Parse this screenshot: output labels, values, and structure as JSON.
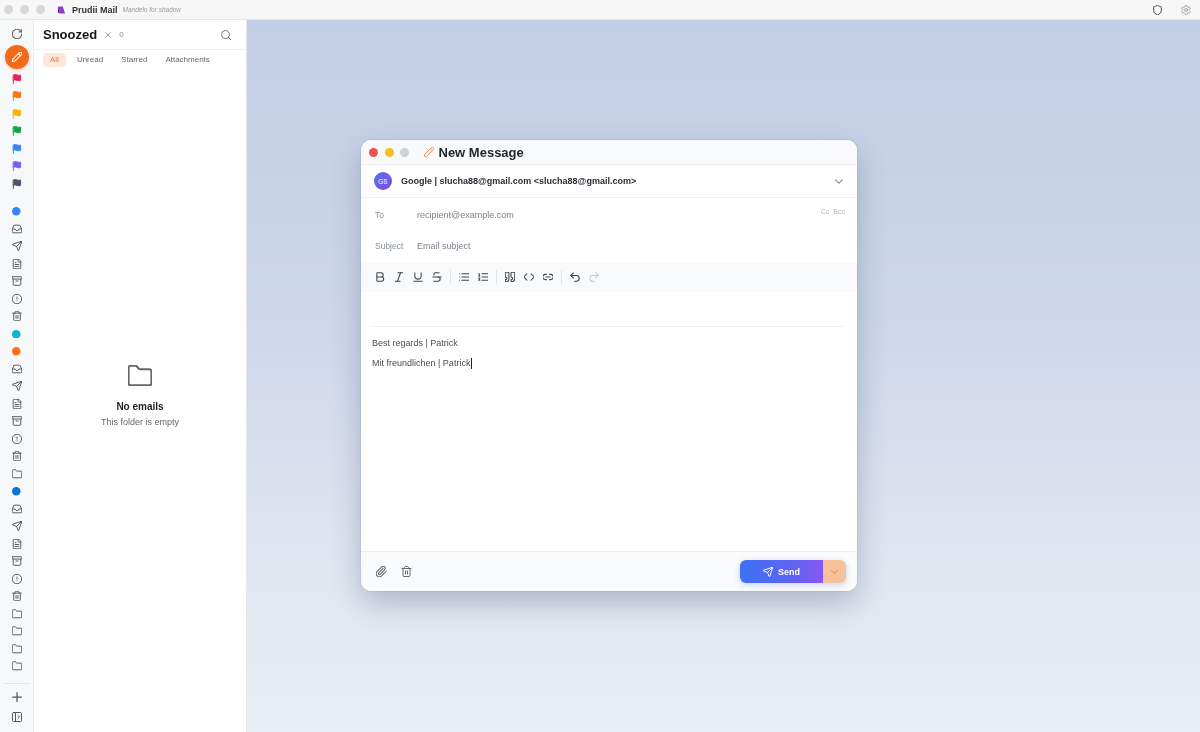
{
  "app": {
    "name": "Prudii Mail",
    "subtitle": "Mandelo for shadow"
  },
  "rail": {
    "flags": [
      {
        "color": "#e0245e"
      },
      {
        "color": "#f97316"
      },
      {
        "color": "#f5b400"
      },
      {
        "color": "#16a34a"
      },
      {
        "color": "#3b82f6"
      },
      {
        "color": "#7c5cf6"
      },
      {
        "color": "#4b5563"
      }
    ],
    "accounts": [
      {
        "color": "#3b82f6",
        "folders": [
          {
            "kind": "inbox"
          },
          {
            "kind": "sent"
          },
          {
            "kind": "drafts"
          },
          {
            "kind": "archive"
          },
          {
            "kind": "spam"
          },
          {
            "kind": "trash"
          }
        ]
      },
      {
        "color": "#06b6d4"
      },
      {
        "color": "#f97316",
        "folders": [
          {
            "kind": "inbox"
          },
          {
            "kind": "sent"
          },
          {
            "kind": "drafts"
          },
          {
            "kind": "archive"
          },
          {
            "kind": "spam"
          },
          {
            "kind": "trash"
          },
          {
            "kind": "folder"
          }
        ]
      },
      {
        "color": "#0b74d1",
        "folders": [
          {
            "kind": "inbox"
          },
          {
            "kind": "sent"
          },
          {
            "kind": "drafts"
          },
          {
            "kind": "archive"
          },
          {
            "kind": "spam"
          },
          {
            "kind": "trash"
          },
          {
            "kind": "folder"
          },
          {
            "kind": "folder"
          },
          {
            "kind": "folder"
          },
          {
            "kind": "folder"
          }
        ]
      }
    ]
  },
  "folder": {
    "title": "Snoozed",
    "count": "0",
    "filters": [
      {
        "label": "All",
        "selected": true
      },
      {
        "label": "Unread",
        "selected": false
      },
      {
        "label": "Starred",
        "selected": false
      },
      {
        "label": "Attachments",
        "selected": false
      }
    ],
    "empty_state": {
      "title": "No emails",
      "message": "This folder is empty"
    }
  },
  "compose": {
    "title": "New Message",
    "from": {
      "initials": "GS",
      "account": "Google | slucha88@gmail.com <slucha88@gmail.com>"
    },
    "to": {
      "label": "To",
      "placeholder": "recipient@example.com"
    },
    "cc_links": [
      "Cc",
      "Bcc"
    ],
    "subject": {
      "label": "Subject",
      "placeholder": "Email subject"
    },
    "toolbar": [
      [
        {
          "kind": "bold",
          "disabled": false
        },
        {
          "kind": "italic",
          "disabled": false
        },
        {
          "kind": "underline",
          "disabled": false
        },
        {
          "kind": "strike",
          "disabled": false
        }
      ],
      [
        {
          "kind": "bullets",
          "disabled": false
        },
        {
          "kind": "numbers",
          "disabled": false
        }
      ],
      [
        {
          "kind": "quote",
          "disabled": false
        },
        {
          "kind": "code",
          "disabled": false
        },
        {
          "kind": "link",
          "disabled": false
        }
      ],
      [
        {
          "kind": "undo",
          "disabled": false
        },
        {
          "kind": "redo",
          "disabled": true
        }
      ]
    ],
    "body": {
      "lines": [
        "Best regards | Patrick",
        "Mit freundlichen | Patrick"
      ],
      "caret": true
    },
    "send_label": "Send"
  }
}
